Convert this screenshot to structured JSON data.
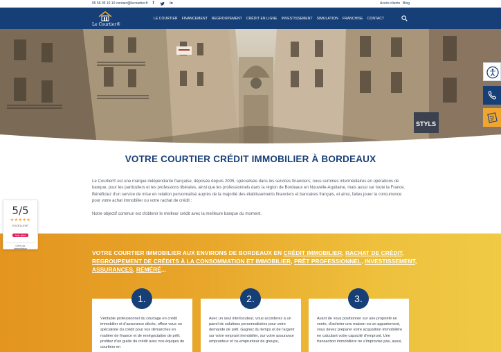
{
  "topbar": {
    "phone": "05 56 05 10 10",
    "email": "contact@lecourtier.fr",
    "social": [
      "facebook-icon",
      "twitter-icon",
      "linkedin-icon"
    ],
    "social_glyphs": [
      "f",
      "t",
      "in"
    ],
    "client_access": "Accès clients",
    "blog": "Blog"
  },
  "nav": {
    "logo_text": "Le Courtier®",
    "items": [
      "LE COURTIER",
      "FINANCEMENT",
      "REGROUPEMENT",
      "CRÉDIT EN LIGNE",
      "INVESTISSEMENT",
      "SIMULATION",
      "FRANCHISE",
      "CONTACT"
    ]
  },
  "colors": {
    "brand": "#173f77",
    "accent": "#e8a62a",
    "orange_widget": "#f0a531"
  },
  "side_widgets": [
    "accessibility-icon",
    "phone-icon",
    "form-icon"
  ],
  "main": {
    "title": "VOTRE COURTIER CRÉDIT IMMOBILIER À BORDEAUX",
    "intro": "Le Courtier® est une marque indépendante française, déposée depuis 2005, spécialisée dans les services financiers; nous sommes intermédiaires en opérations de banque, pour les particuliers et les professions libérales, ainsi que les professionnels dans la région de Bordeaux en Nouvelle-Aquitaine, mais aussi sur toute la France. Bénéficiez d'un service de mise en relation personnalisé auprès de la majorité des établissements financiers et bancaires français, et ainsi, faites jouer la concurrence pour votre achat immobilier ou votre rachat de crédit :",
    "intro2": "Notre objectif commun est d'obtenir le meilleur crédit avec la meilleure banque du moment."
  },
  "rating": {
    "score": "5/5",
    "stars": "★★★★★",
    "label": "EXCELLENT",
    "button": "Voir plus",
    "managed_by": "Géré par",
    "provider": "Immodvisor"
  },
  "section": {
    "title_prefix": "VOTRE COURTIER IMMOBILIER AUX ENVIRONS DE BORDEAUX EN ",
    "links": [
      "CRÉDIT IMMOBILIER",
      "RACHAT DE CRÉDIT",
      "REGROUPEMENT DE CRÉDITS À LA CONSOMMATION ET IMMOBILIER",
      "PRÊT PROFESSIONNEL",
      "INVESTISSEMENT",
      "ASSURANCES",
      "RÉMÉRÉ"
    ],
    "sep": ", ",
    "suffix": "...",
    "cards": [
      {
        "number": "1.",
        "text": "Véritable professionnel du courtage en crédit immobilier et d'assurance décès, offrez vous un spécialiste du crédit pour vos démarches en matière de finance et de renégociation de prêt; profitez d'un guide du crédit avec nos équipes de courtiers en"
      },
      {
        "number": "2.",
        "text": "Avec un seul interlocuteur, vous accéderez à un panel de solutions personnalisées pour votre demande de prêt. Gagnez du temps et de l'argent sur votre emprunt immobilier, sur votre assurance emprunteur et co-emprunteur de groupe,"
      },
      {
        "number": "3.",
        "text": "Avant de vous positionner sur une propriété en vente, d'acheter une maison ou un appartement, vous devez préparer votre acquisition immobilière en calculant votre capacité d'emprunt. Une transaction immobilière ne s'improvise pas, aussi,"
      }
    ]
  }
}
